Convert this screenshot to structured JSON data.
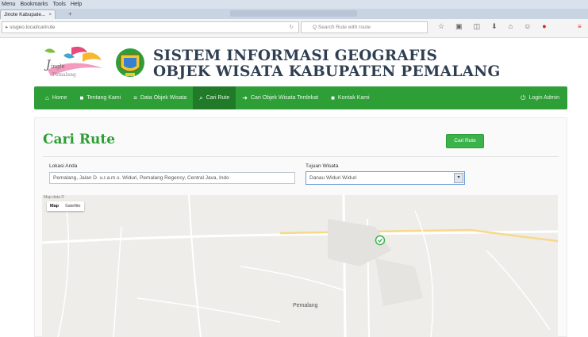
{
  "browser": {
    "menu": [
      "Menu",
      "Bookmarks",
      "Tools",
      "Help"
    ],
    "tab_title": "Jinote Kabupate...",
    "tab_close": "×",
    "new_tab": "+",
    "url": "▸ sisgeo.local/carirute",
    "search_placeholder": "Q  Search Rute with route"
  },
  "header": {
    "title_line1": "SISTEM INFORMASI GEOGRAFIS",
    "title_line2": "OBJEK WISATA KABUPATEN PEMALANG"
  },
  "nav": {
    "items": [
      {
        "icon": "home-icon",
        "glyph": "⌂",
        "label": "Home"
      },
      {
        "icon": "info-icon",
        "glyph": "■",
        "label": "Tentang Kami"
      },
      {
        "icon": "list-icon",
        "glyph": "≡",
        "label": "Data Objek Wisata"
      },
      {
        "icon": "search-icon",
        "glyph": "⌕",
        "label": "Cari Rute"
      },
      {
        "icon": "location-icon",
        "glyph": "➜",
        "label": "Cari Objek Wisata Terdekat"
      },
      {
        "icon": "envelope-icon",
        "glyph": "■",
        "label": "Kontak Kami"
      }
    ],
    "login": {
      "icon": "login-icon",
      "glyph": "⏻",
      "label": "Login Admin"
    }
  },
  "main": {
    "heading": "Cari Rute",
    "lokasi_label": "Lokasi Anda",
    "lokasi_value": "Pemalang, Jalan D. u.r.a.m.s. Widuri, Pemalang Regency, Central Java, Indo",
    "tujuan_label": "Tujuan Wisata",
    "tujuan_value": "Danau Widuri Widuri",
    "button_label": "Cari Rute"
  },
  "map": {
    "corner": "Map data ©",
    "types": [
      "Map",
      "Satellite"
    ],
    "city_label": "Pemalang"
  },
  "colors": {
    "nav_green": "#2e9e36",
    "nav_active": "#217a28",
    "title_color": "#2f3f52",
    "heading_green": "#2e9e36"
  }
}
